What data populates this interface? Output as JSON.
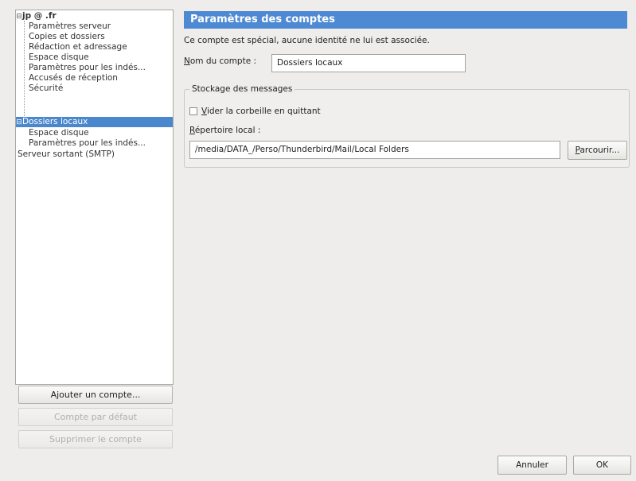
{
  "tree": {
    "account_name": "jp     @     .fr",
    "account_children": [
      "Paramètres serveur",
      "Copies et dossiers",
      "Rédaction et adressage",
      "Espace disque",
      "Paramètres pour les indés...",
      "Accusés de réception",
      "Sécurité"
    ],
    "local_folders": "Dossiers locaux",
    "local_children": [
      "Espace disque",
      "Paramètres pour les indés..."
    ],
    "smtp": "Serveur sortant (SMTP)",
    "expander_open": "⊟",
    "expander_local": "⊟"
  },
  "left_buttons": {
    "add_account": "Ajouter un compte...",
    "default_account": "Compte par défaut",
    "delete_account": "Supprimer le compte"
  },
  "panel": {
    "title": "Paramètres des comptes",
    "special_note": "Ce compte est spécial, aucune identité ne lui est associée.",
    "account_name_label_mnemonic": "N",
    "account_name_label_rest": "om du compte :",
    "account_name_value": "Dossiers locaux",
    "storage_legend": "Stockage des messages",
    "empty_trash_mnemonic": "V",
    "empty_trash_rest": "ider la corbeille en quittant",
    "local_dir_label_mnemonic": "R",
    "local_dir_label_rest": "épertoire local :",
    "local_dir_value": "/media/DATA_/Perso/Thunderbird/Mail/Local Folders",
    "browse_mnemonic": "P",
    "browse_rest": "arcourir..."
  },
  "footer": {
    "cancel": "Annuler",
    "ok": "OK"
  },
  "colors": {
    "header_bg": "#4e8ad3",
    "selection_bg": "#4a87cc"
  }
}
